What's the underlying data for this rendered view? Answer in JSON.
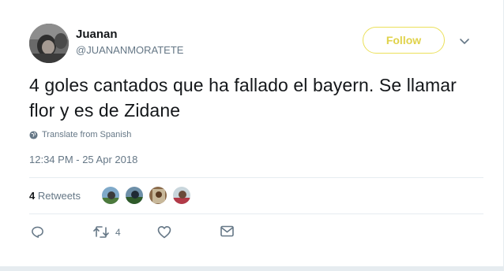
{
  "author": {
    "display_name": "Juanan",
    "handle": "@JUANANMORATETE",
    "avatar_icon": "user-avatar"
  },
  "follow_button": {
    "label": "Follow",
    "color": "#e0d24a"
  },
  "tweet": {
    "text": "4 goles cantados que ha fallado el bayern. Se llamar flor y es de Zidane",
    "translate_label": "Translate from Spanish",
    "timestamp": "12:34 PM - 25 Apr 2018"
  },
  "stats": {
    "retweet_count": "4",
    "retweet_label": " Retweets",
    "retweeter_avatars": [
      "retweeter-avatar-1",
      "retweeter-avatar-2",
      "retweeter-avatar-3",
      "retweeter-avatar-4"
    ]
  },
  "actions": {
    "reply_icon": "reply-icon",
    "retweet_icon": "retweet-icon",
    "retweet_count": "4",
    "like_icon": "heart-icon",
    "dm_icon": "envelope-icon"
  },
  "colors": {
    "text": "#14171a",
    "secondary": "#657786",
    "divider": "#e6ecf0",
    "follow_border": "#ebe05a"
  }
}
